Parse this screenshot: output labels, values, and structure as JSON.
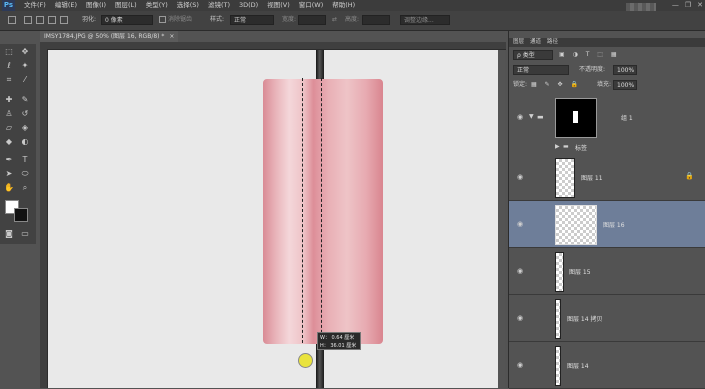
{
  "app": {
    "logo": "Ps"
  },
  "menu": {
    "items": [
      "文件(F)",
      "编辑(E)",
      "图像(I)",
      "图层(L)",
      "类型(Y)",
      "选择(S)",
      "滤镜(T)",
      "3D(D)",
      "视图(V)",
      "窗口(W)",
      "帮助(H)"
    ]
  },
  "window_controls": {
    "minimize": "—",
    "restore": "❐",
    "close": "✕"
  },
  "options": {
    "feather_label": "羽化:",
    "feather_value": "0 像素",
    "antialias_label": "消除锯齿",
    "style_label": "样式:",
    "style_value": "正常",
    "width_label": "宽度:",
    "height_label": "高度:",
    "refine_button": "调整边缘..."
  },
  "document": {
    "tab_title": "IMSY1784.JPG @ 50% (图层 16, RGB/8) *",
    "tab_close": "×"
  },
  "tooltip": {
    "w_line": "W： 0.64 厘米",
    "h_line": "H： 36.01 厘米"
  },
  "panel": {
    "tabs": [
      "图层",
      "通道",
      "路径"
    ],
    "filter_kind": "ρ 类型",
    "blend_mode": "正常",
    "opacity_label": "不透明度:",
    "opacity_value": "100%",
    "lock_label": "锁定:",
    "fill_label": "填充:",
    "fill_value": "100%",
    "layers": [
      {
        "name": "组 1"
      },
      {
        "name": "标签"
      },
      {
        "name": "图层 11"
      },
      {
        "name": "图层 16"
      },
      {
        "name": "图层 15"
      },
      {
        "name": "图层 14 拷贝"
      },
      {
        "name": "图层 14"
      }
    ]
  },
  "colors": {
    "foreground": "#ffffff",
    "background": "#111111",
    "selected_layer": "#6e7e99"
  }
}
